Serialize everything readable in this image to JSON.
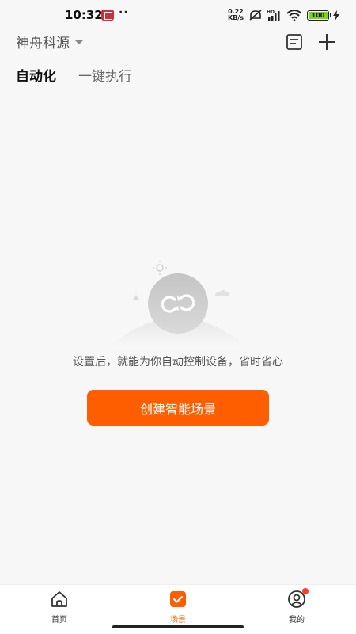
{
  "status_bar": {
    "time": "10:32",
    "dots": "··",
    "speed_value": "0.22",
    "speed_unit": "KB/s",
    "battery": "100"
  },
  "header": {
    "home_name": "神舟科源"
  },
  "tabs": [
    {
      "label": "自动化",
      "active": true
    },
    {
      "label": "一键执行",
      "active": false
    }
  ],
  "empty_state": {
    "message": "设置后，就能为你自动控制设备，省时省心",
    "create_button": "创建智能场景"
  },
  "bottom_nav": [
    {
      "label": "首页",
      "icon": "home-icon"
    },
    {
      "label": "场景",
      "icon": "scene-icon",
      "active": true
    },
    {
      "label": "我的",
      "icon": "profile-icon"
    }
  ],
  "colors": {
    "accent": "#ff5e00",
    "background": "#f7f7f7",
    "badge": "#ff3b30"
  }
}
